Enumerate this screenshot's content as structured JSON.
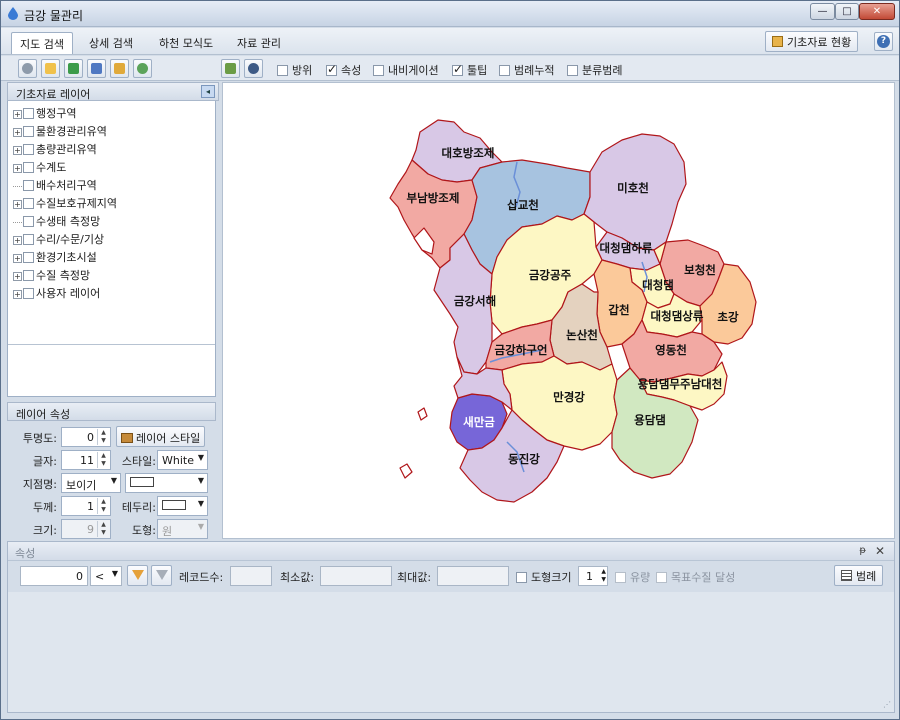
{
  "window": {
    "title": "금강 물관리"
  },
  "menu": {
    "tabs": [
      "지도 검색",
      "상세 검색",
      "하천 모식도",
      "자료 관리"
    ],
    "active_tab": "지도 검색",
    "right_button": "기초자료 현황",
    "help": "?"
  },
  "toolbar": {
    "checkboxes": [
      {
        "label": "방위",
        "checked": false
      },
      {
        "label": "속성",
        "checked": true
      },
      {
        "label": "내비게이션",
        "checked": false
      },
      {
        "label": "툴팁",
        "checked": true
      },
      {
        "label": "범례누적",
        "checked": false
      },
      {
        "label": "분류범례",
        "checked": false
      }
    ]
  },
  "layers": {
    "title": "기초자료 레이어",
    "items": [
      {
        "label": "행정구역",
        "expandable": true
      },
      {
        "label": "물환경관리유역",
        "expandable": true
      },
      {
        "label": "총량관리유역",
        "expandable": true
      },
      {
        "label": "수계도",
        "expandable": true
      },
      {
        "label": "배수처리구역",
        "expandable": false
      },
      {
        "label": "수질보호규제지역",
        "expandable": true
      },
      {
        "label": "수생태 측정망",
        "expandable": false
      },
      {
        "label": "수리/수문/기상",
        "expandable": true
      },
      {
        "label": "환경기초시설",
        "expandable": true
      },
      {
        "label": "수질 측정망",
        "expandable": true
      },
      {
        "label": "사용자 레이어",
        "expandable": true
      }
    ]
  },
  "layer_props": {
    "title": "레이어 속성",
    "transparency_label": "투명도:",
    "transparency_value": "0",
    "style_button": "레이어 스타일",
    "font_label": "글자:",
    "font_value": "11",
    "style_label": "스타일:",
    "style_value": "White",
    "place_label": "지점명:",
    "place_value": "보이기",
    "thickness_label": "두께:",
    "thickness_value": "1",
    "border_label": "테두리:",
    "size_label": "크기:",
    "size_value": "9",
    "shape_label": "도형:",
    "shape_value": "원"
  },
  "map": {
    "regions": [
      {
        "name": "대호방조제",
        "color": "#d8c8e6"
      },
      {
        "name": "부남방조제",
        "color": "#f2a9a3"
      },
      {
        "name": "삽교천",
        "color": "#a7c3e0"
      },
      {
        "name": "미호천",
        "color": "#d8c8e6"
      },
      {
        "name": "대청댐하류",
        "color": "#d8c8e6"
      },
      {
        "name": "금강공주",
        "color": "#fdf7c4"
      },
      {
        "name": "보청천",
        "color": "#f2a9a3"
      },
      {
        "name": "대청댐",
        "color": "#fdf7c4"
      },
      {
        "name": "금강서해",
        "color": "#d8c8e6"
      },
      {
        "name": "갑천",
        "color": "#fbc99a"
      },
      {
        "name": "대청댐상류",
        "color": "#fdf7c4"
      },
      {
        "name": "초강",
        "color": "#fbc99a"
      },
      {
        "name": "논산천",
        "color": "#e4d2bf"
      },
      {
        "name": "금강하구언",
        "color": "#f2a9a3"
      },
      {
        "name": "영동천",
        "color": "#f2a9a3"
      },
      {
        "name": "용담댐무주남대천",
        "color": "#fdf7c4"
      },
      {
        "name": "만경강",
        "color": "#fdf7c4"
      },
      {
        "name": "용담댐",
        "color": "#d1e8c1"
      },
      {
        "name": "새만금",
        "color": "#7766d8"
      },
      {
        "name": "동진강",
        "color": "#d8c8e6"
      }
    ]
  },
  "attributes": {
    "title": "속성",
    "value": "0",
    "operator": "<",
    "record_label": "레코드수:",
    "min_label": "최소값:",
    "max_label": "최대값:",
    "shape_size_label": "도형크기",
    "shape_size_value": "1",
    "flow_label": "유량",
    "target_label": "목표수질 달성",
    "legend_button": "범례"
  }
}
